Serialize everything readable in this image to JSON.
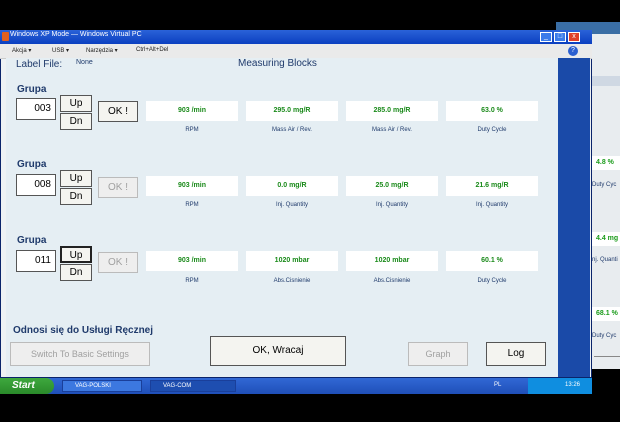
{
  "window": {
    "title": "Windows XP Mode — Windows Virtual PC",
    "minimize": "_",
    "maximize": "□",
    "close": "x"
  },
  "menu": [
    "Akcja ▾",
    "USB ▾",
    "Narzędzia ▾",
    "Ctrl+Alt+Del"
  ],
  "help": "?",
  "header": {
    "label_file_label": "Label File:",
    "label_file_value": "None",
    "section_title": "Measuring Blocks"
  },
  "groups": [
    {
      "label": "Grupa",
      "number": "003",
      "up": "Up",
      "dn": "Dn",
      "ok": "OK !",
      "ok_enabled": true,
      "fields": [
        {
          "value": "903 /min",
          "label": "RPM"
        },
        {
          "value": "295.0 mg/R",
          "label": "Mass Air / Rev."
        },
        {
          "value": "285.0 mg/R",
          "label": "Mass Air / Rev."
        },
        {
          "value": "63.0 %",
          "label": "Duty Cycle"
        }
      ]
    },
    {
      "label": "Grupa",
      "number": "008",
      "up": "Up",
      "dn": "Dn",
      "ok": "OK !",
      "ok_enabled": false,
      "fields": [
        {
          "value": "903 /min",
          "label": "RPM"
        },
        {
          "value": "0.0 mg/R",
          "label": "Inj. Quantity"
        },
        {
          "value": "25.0 mg/R",
          "label": "Inj. Quantity"
        },
        {
          "value": "21.6 mg/R",
          "label": "Inj. Quantity"
        }
      ]
    },
    {
      "label": "Grupa",
      "number": "011",
      "up": "Up",
      "dn": "Dn",
      "ok": "OK !",
      "ok_enabled": false,
      "fields": [
        {
          "value": "903 /min",
          "label": "RPM"
        },
        {
          "value": "1020 mbar",
          "label": "Abs.Cisnienie"
        },
        {
          "value": "1020 mbar",
          "label": "Abs.Cisnienie"
        },
        {
          "value": "60.1 %",
          "label": "Duty Cycle"
        }
      ]
    }
  ],
  "footer": {
    "odnosi": "Odnosi się do Usługi Ręcznej",
    "switch_basic": "Switch To Basic Settings",
    "ok_back": "OK, Wracaj",
    "graph": "Graph",
    "log": "Log"
  },
  "background_window": {
    "values": [
      "4.8 %",
      "4.4 mg",
      "68.1 %"
    ],
    "labels": [
      "Duty Cyc",
      "nj. Quanti",
      "Duty Cyc"
    ]
  },
  "taskbar": {
    "start": "Start",
    "tasks": [
      "VAG-POLSKI",
      "VAG-COM"
    ],
    "lang": "PL",
    "clock": "13:26"
  }
}
